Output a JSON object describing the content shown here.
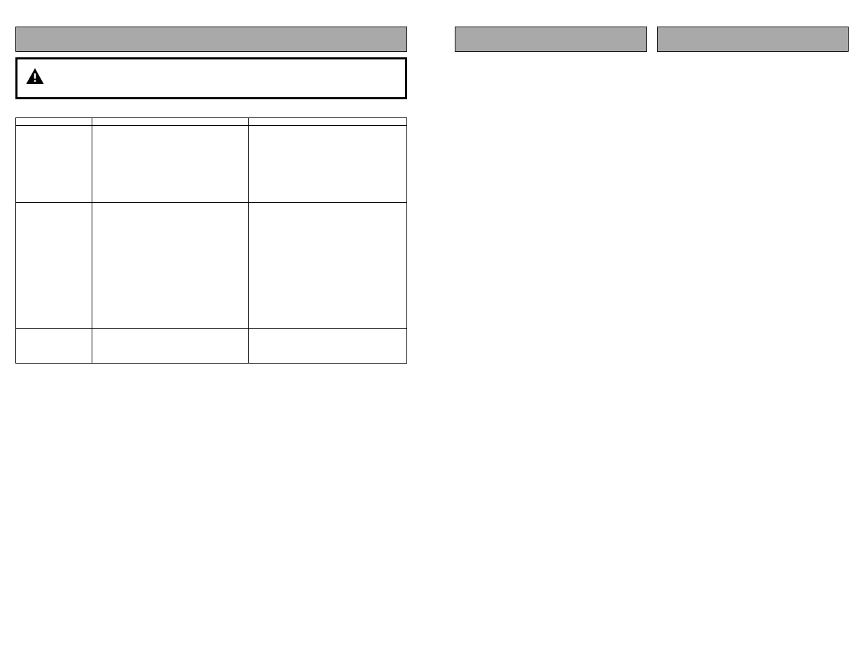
{
  "left": {
    "warning_text": "",
    "intro_text": "",
    "table": {
      "headers": [
        "",
        "",
        ""
      ],
      "rows": [
        [
          "",
          "",
          ""
        ],
        [
          "",
          "",
          ""
        ],
        [
          "",
          "",
          ""
        ]
      ]
    }
  },
  "right": {}
}
